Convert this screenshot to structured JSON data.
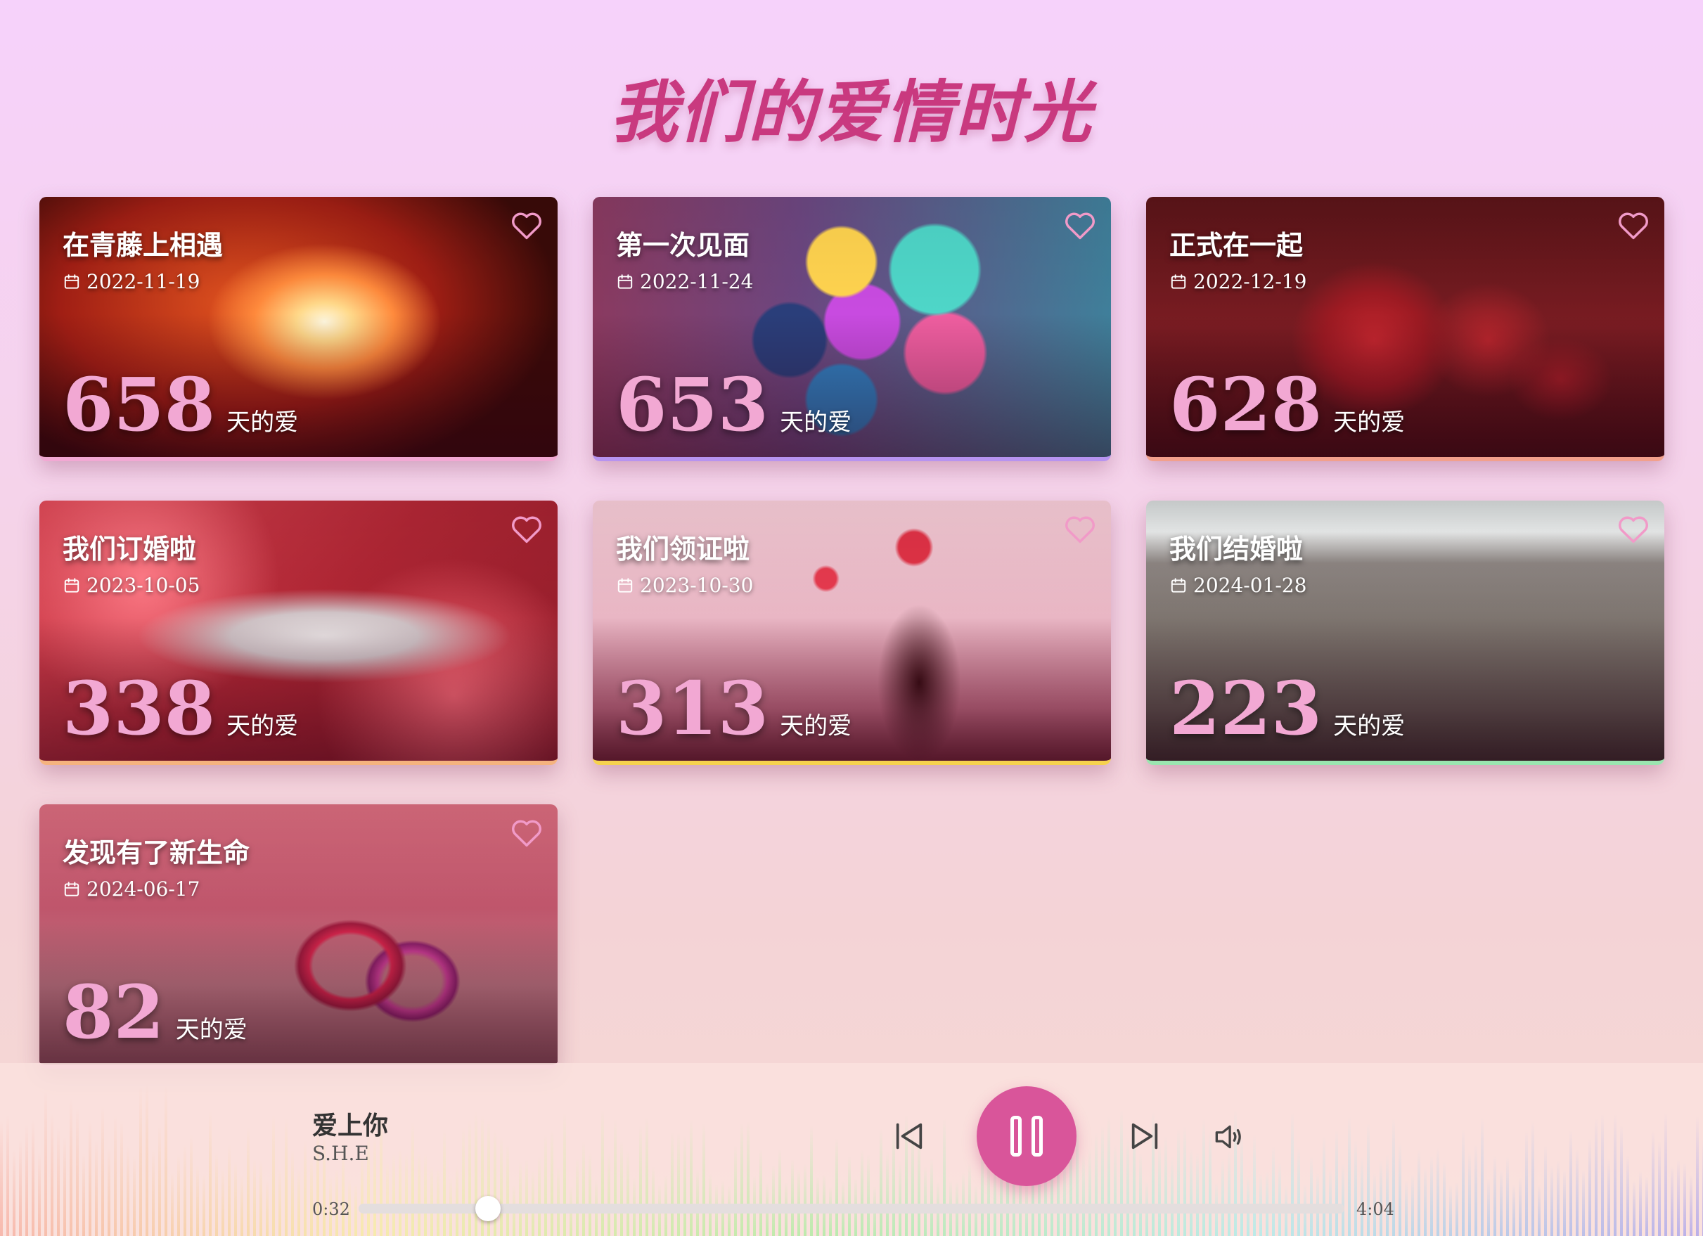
{
  "page": {
    "title": "我们的爱情时光"
  },
  "cards": [
    {
      "title": "在青藤上相遇",
      "date": "2022-11-19",
      "days": "658",
      "unit": "天的爱",
      "accent": "#f2a8d3",
      "bg": "radial-gradient(ellipse 30% 40% at 55% 48%, #fff8e0 0%, #ffd98a 18%, #ff8a3c 45%, rgba(200,40,20,0) 75%), radial-gradient(ellipse 60% 70% at 40% 40%, #e2541f 0%, #a01e14 60%, #3a0a08 100%)"
    },
    {
      "title": "第一次见面",
      "date": "2022-11-24",
      "days": "653",
      "unit": "天的爱",
      "accent": "#b793f0",
      "bg": "radial-gradient(circle at 48% 25%, #ffd34f 0 10%, rgba(0,0,0,0) 11%), radial-gradient(circle at 66% 28%, #4ed6c8 0 11%, rgba(0,0,0,0) 12%), radial-gradient(circle at 52% 48%, #c84be0 0 12%, rgba(0,0,0,0) 13%), radial-gradient(circle at 38% 55%, #2a3e7a 0 10%, rgba(0,0,0,0) 11%), radial-gradient(circle at 68% 60%, #ef5ea0 0 10%, rgba(0,0,0,0) 11%), radial-gradient(circle at 48% 78%, #2f7fc0 0 10%, rgba(0,0,0,0) 11%), linear-gradient(90deg, #8a3a60 0%, #6c4680 40%, #3f7f9a 100%)"
    },
    {
      "title": "正式在一起",
      "date": "2022-12-19",
      "days": "628",
      "unit": "天的爱",
      "accent": "#f2a08c",
      "bg": "radial-gradient(ellipse 16% 30% at 44% 55%, #c3262e 0%, #9c1a22 60%, rgba(0,0,0,0) 100%), radial-gradient(ellipse 12% 22% at 66% 55%, #b8252c 0%, rgba(0,0,0,0) 100%), radial-gradient(ellipse 10% 16% at 80% 70%, #a31e26 0%, rgba(0,0,0,0) 100%), linear-gradient(180deg, #5a1418 0%, #7a1c22 50%, #4a1013 100%)"
    },
    {
      "title": "我们订婚啦",
      "date": "2023-10-05",
      "days": "338",
      "unit": "天的爱",
      "accent": "#f5b37e",
      "bg": "radial-gradient(ellipse 60% 30% at 55% 52%, #e9e3e4 0%, #cfc3c6 30%, rgba(0,0,0,0) 60%), radial-gradient(circle at 20% 30%, #ff7a86 0%, rgba(0,0,0,0) 30%), radial-gradient(circle at 80% 75%, #ff6a78 0%, rgba(0,0,0,0) 30%), linear-gradient(135deg, #d94452 0%, #b02634 50%, #8c1a28 100%)"
    },
    {
      "title": "我们领证啦",
      "date": "2023-10-30",
      "days": "313",
      "unit": "天的爱",
      "accent": "#f6d24e",
      "bg": "radial-gradient(ellipse 8% 30% at 63% 70%, #3a0e14 0%, rgba(0,0,0,0) 100%), radial-gradient(circle at 45% 30%, #e63a4e 0 3%, rgba(0,0,0,0) 4%), radial-gradient(circle at 62% 18%, #e03246 0 4%, rgba(0,0,0,0) 5%), linear-gradient(180deg, #f3c9d4 0%, #e9b6c4 45%, #c46a82 80%, #7a2a3c 100%)"
    },
    {
      "title": "我们结婚啦",
      "date": "2024-01-28",
      "days": "223",
      "unit": "天的爱",
      "accent": "#9be5b0",
      "bg": "linear-gradient(180deg, #cfd3d3 0%, #eaecec 12%, #8d8582 24%, #7a716b 50%, #5e5550 80%, #3d3532 100%)"
    },
    {
      "title": "发现有了新生命",
      "date": "2024-06-17",
      "days": "82",
      "unit": "天的爱",
      "accent": "#f2a8d3",
      "bg": "radial-gradient(ellipse 16% 26% at 60% 62%, rgba(0,0,0,0) 0 45%, #d0244a 50%, #9b1a3c 62%, rgba(0,0,0,0) 68%), radial-gradient(ellipse 14% 24% at 72% 68%, rgba(0,0,0,0) 0 40%, #c23a8e 48%, #8a2068 60%, rgba(0,0,0,0) 66%), linear-gradient(180deg, #d66a7c 0%, #c0566c 40%, #b9737f 70%, #9a5a66 100%)"
    }
  ],
  "player": {
    "song_title": "爱上你",
    "artist": "S.H.E",
    "current_time": "0:32",
    "total_time": "4:04",
    "progress": 0.131,
    "state": "playing"
  }
}
